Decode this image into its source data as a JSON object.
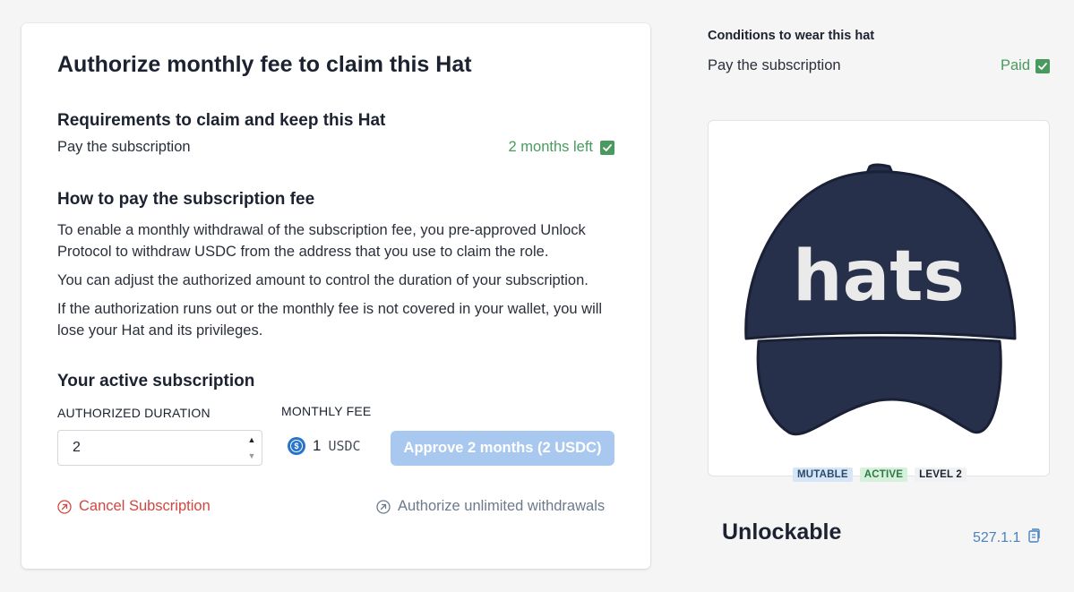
{
  "main": {
    "title": "Authorize monthly fee to claim this Hat",
    "requirements": {
      "heading": "Requirements to claim and keep this Hat",
      "item_label": "Pay the subscription",
      "item_status": "2 months left"
    },
    "how_to_pay": {
      "heading": "How to pay the subscription fee",
      "paragraph_1": "To enable a monthly withdrawal of the subscription fee, you pre-approved Unlock Protocol to withdraw USDC from the address that you use to claim the role.",
      "paragraph_2": "You can adjust the authorized amount to control the duration of your subscription.",
      "paragraph_3": "If the authorization runs out or the monthly fee is not covered in your wallet, you will lose your Hat and its privileges."
    },
    "subscription": {
      "heading": "Your active subscription",
      "duration_label": "AUTHORIZED DURATION",
      "duration_value": "2",
      "fee_label": "MONTHLY FEE",
      "fee_amount": "1",
      "fee_unit": "USDC",
      "approve_button": "Approve 2 months (2 USDC)"
    },
    "cancel_link": "Cancel Subscription",
    "unlimited_link": "Authorize unlimited withdrawals"
  },
  "sidebar": {
    "conditions_title": "Conditions to wear this hat",
    "condition_label": "Pay the subscription",
    "condition_status": "Paid",
    "hat_image_text": "hats",
    "badges": [
      "MUTABLE",
      "ACTIVE",
      "LEVEL 2"
    ],
    "hat_name": "Unlockable",
    "hat_id": "527.1.1"
  },
  "colors": {
    "success": "#4a9a5f",
    "danger": "#d2463f",
    "primary_disabled": "#a9c8ef",
    "hat_navy": "#27304a",
    "usdc": "#2775ca"
  },
  "icons": {
    "check": "check-square-icon",
    "cancel": "circle-arrow-icon",
    "unlimited": "circle-arrow-icon",
    "copy": "copy-icon",
    "coin": "usdc-coin-icon"
  }
}
